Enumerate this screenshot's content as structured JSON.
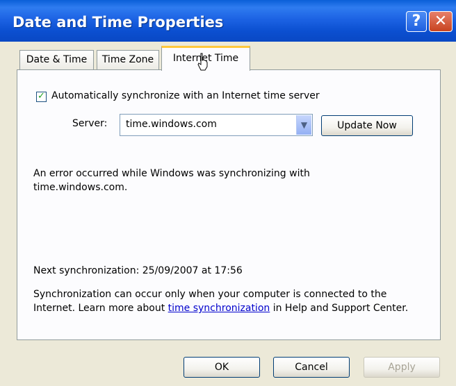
{
  "window": {
    "title": "Date and Time Properties",
    "help_label": "?",
    "close_label": "✕"
  },
  "tabs": [
    {
      "label": "Date & Time"
    },
    {
      "label": "Time Zone"
    },
    {
      "label": "Internet Time",
      "active": true
    }
  ],
  "internet_time": {
    "auto_sync_checked": true,
    "auto_sync_label": "Automatically synchronize with an Internet time server",
    "server_label": "Server:",
    "server_value": "time.windows.com",
    "update_now_label": "Update Now",
    "error_message": "An error occurred while Windows was synchronizing with time.windows.com.",
    "next_sync": "Next synchronization: 25/09/2007 at 17:56",
    "info_prefix": "Synchronization can occur only when your computer is connected to the Internet.  Learn more about ",
    "info_link": "time synchronization",
    "info_suffix": " in Help and Support Center."
  },
  "buttons": {
    "ok": "OK",
    "cancel": "Cancel",
    "apply": "Apply"
  },
  "colors": {
    "titlebar": "#0a5fd8",
    "active_tab_highlight": "#ffc83c",
    "link": "#0000cc"
  },
  "icons": {
    "help": "question-mark",
    "close": "x-mark",
    "checkbox": "check-mark",
    "combo_arrow": "chevron-down",
    "cursor": "hand-pointer"
  }
}
